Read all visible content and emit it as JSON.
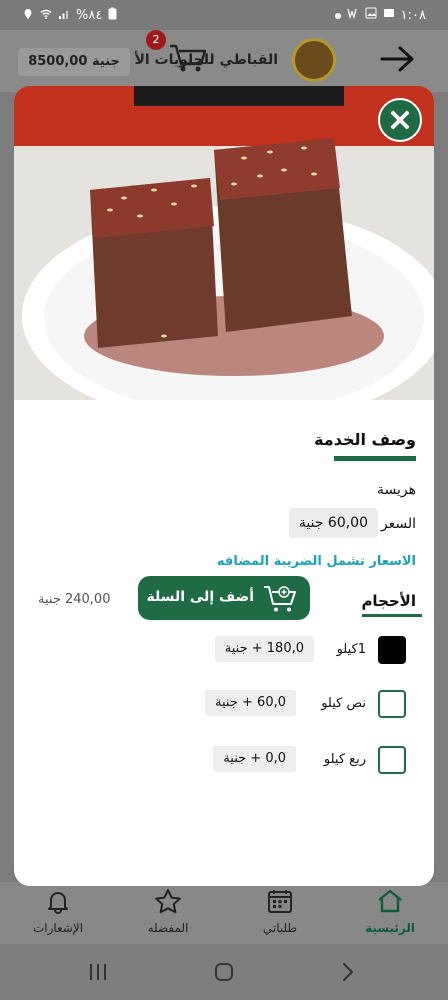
{
  "status": {
    "time": "١:٠٨",
    "battery": "%٨٤"
  },
  "header": {
    "store_name": "القباطي للحلويات الأ",
    "cart_count": "2",
    "balance": "8500,00 جنية"
  },
  "modal": {
    "section_title": "وصف الخدمة",
    "product_name": "هريسة",
    "price_label": "السعر",
    "price_value": "60,00 جنية",
    "tax_note": "الاسعار تشمل الضريبة المضافه",
    "sizes_title": "الأحجام",
    "options": [
      {
        "label": "1كيلو",
        "price": "180,0  +  جنية",
        "checked": true
      },
      {
        "label": "نص كيلو",
        "price": "60,0  +  جنية",
        "checked": false
      },
      {
        "label": "ربع كيلو",
        "price": "0,0  +  جنية",
        "checked": false
      }
    ],
    "add_to_cart": "أضف إلى السلة",
    "total": "240,00 جنية"
  },
  "bottom_nav": {
    "home": "الرئيسية",
    "orders": "طلباتي",
    "favorites": "المفضله",
    "notifications": "الإشعارات"
  },
  "colors": {
    "primary": "#1f6b45",
    "tax_note": "#1aa3b8",
    "badge": "#a01a1a"
  }
}
